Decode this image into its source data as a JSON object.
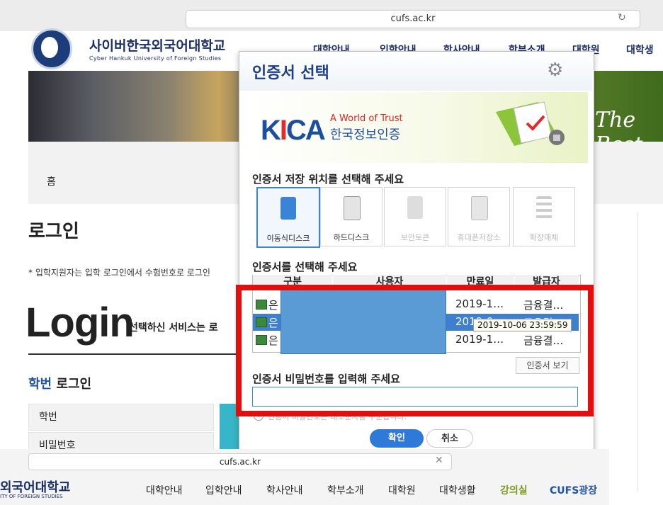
{
  "browser": {
    "url": "cufs.ac.kr"
  },
  "site": {
    "logo_kr": "사이버한국외국어대학교",
    "logo_en": "Cyber Hankuk University of Foreign Studies",
    "nav": [
      "대학안내",
      "입학안내",
      "학사안내",
      "학부소개",
      "대학원",
      "대학생"
    ],
    "banner_text": "The Best",
    "breadcrumb_home": "홈",
    "login_title": "로그인",
    "notice": "* 입학지원자는 입학 로그인에서 수험번호로 로그인",
    "big_login": "Login",
    "login_sub": "선택하신 서비스는 로",
    "hakbun_accent": "학번",
    "hakbun_rest": " 로그인",
    "field_id": "학번",
    "field_pw": "비밀번호"
  },
  "dialog": {
    "title": "인증서 선택",
    "kica_tagline": "A World of Trust",
    "kica_name": "한국정보인증",
    "storage_label": "인증서 저장 위치를 선택해 주세요",
    "storage": [
      {
        "label": "이동식디스크",
        "selected": true
      },
      {
        "label": "하드디스크",
        "selected": false
      },
      {
        "label": "보안토큰",
        "selected": false
      },
      {
        "label": "휴대폰저장소",
        "selected": false
      },
      {
        "label": "확장매체",
        "selected": false
      }
    ],
    "cert_label": "인증서를 선택해 주세요",
    "columns": [
      "구분",
      "사용자",
      "만료일",
      "발급자"
    ],
    "rows": [
      {
        "type": "은",
        "expiry": "2019-1…",
        "issuer": "금융결…"
      },
      {
        "type": "은",
        "expiry": "2019-0",
        "issuer": "금융결"
      },
      {
        "type": "은",
        "expiry": "2019-1…",
        "issuer": "금융결…"
      }
    ],
    "tooltip": "2019-10-06 23:59:59",
    "view_cert": "인증서 보기",
    "password_label": "인증서 비밀번호를 입력해 주세요",
    "password_hint": "인증서 비밀번호는 대소문자를 구분합니다.",
    "ok": "확인",
    "cancel": "취소"
  },
  "overlay": {
    "url": "cufs.ac.kr",
    "logo_kr": "외국어대학교",
    "logo_en": "ITY OF FOREIGN STUDIES",
    "nav": [
      "대학안내",
      "입학안내",
      "학사안내",
      "학부소개",
      "대학원",
      "대학생활",
      "강의실",
      "CUFS광장"
    ]
  },
  "colors": {
    "accent": "#2f79d8",
    "highlight": "#e30e0e",
    "brand": "#1b2f66"
  }
}
